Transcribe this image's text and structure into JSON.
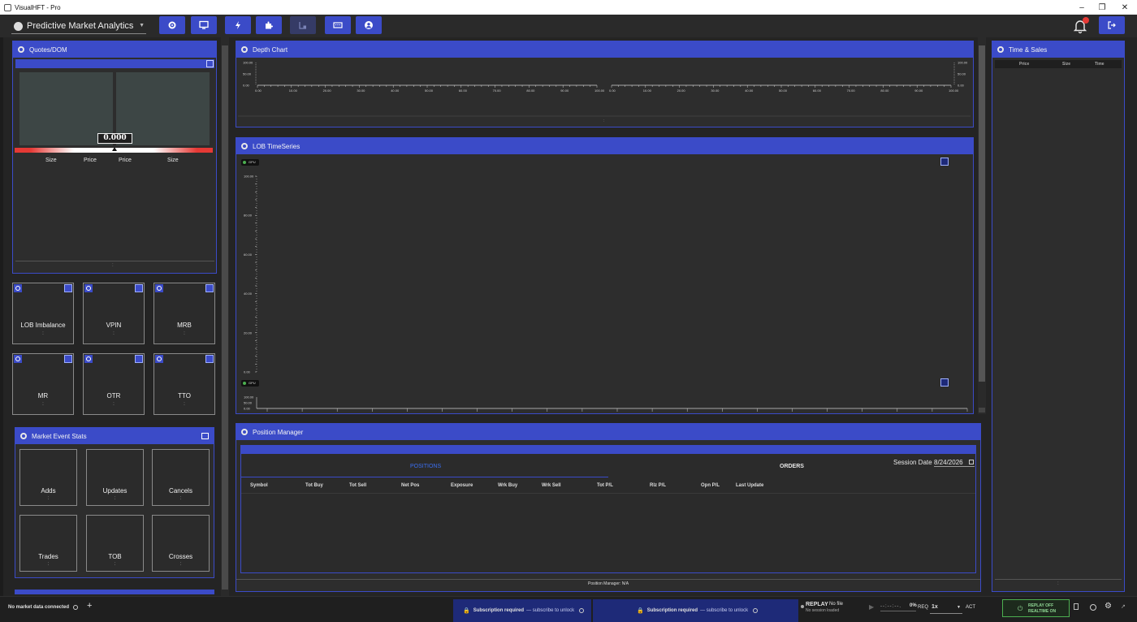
{
  "window": {
    "title": "VisualHFT - Pro"
  },
  "toolbar": {
    "study_select": "Predictive Market Analytics"
  },
  "notifications": {
    "count": ""
  },
  "quotes": {
    "title": "Quotes/DOM",
    "mid_price": "0.000",
    "cols": [
      "Size",
      "Price",
      "Price",
      "Size"
    ]
  },
  "tiles": [
    {
      "label": "LOB Imbalance"
    },
    {
      "label": "VPIN"
    },
    {
      "label": "MRB"
    },
    {
      "label": "MR"
    },
    {
      "label": "OTR"
    },
    {
      "label": "TTO"
    }
  ],
  "market_event_stats": {
    "title": "Market Event Stats",
    "items": [
      "Adds",
      "Updates",
      "Cancels",
      "Trades",
      "TOB",
      "Crosses"
    ]
  },
  "depth_chart": {
    "title": "Depth Chart",
    "y_ticks": [
      "100.00",
      "50.00",
      "0.00"
    ],
    "x_ticks": [
      "0.00",
      "10.00",
      "20.00",
      "30.00",
      "40.00",
      "50.00",
      "60.00",
      "70.00",
      "80.00",
      "90.00",
      "100.00"
    ]
  },
  "lob_timeseries": {
    "title": "LOB TimeSeries",
    "gpu_label": "GPU",
    "y_ticks": [
      "100.00",
      "80.00",
      "60.00",
      "40.00",
      "20.00",
      "0.00"
    ],
    "small_y_ticks": [
      "100.00",
      "50.00",
      "0.00"
    ]
  },
  "position_manager": {
    "title": "Position Manager",
    "tabs": [
      "POSITIONS",
      "ORDERS"
    ],
    "session_label": "Session Date",
    "session_date": "8/24/2026",
    "columns": [
      "Symbol",
      "Tot Buy",
      "Tot Sell",
      "Net Pos",
      "Exposure",
      "Wrk Buy",
      "Wrk Sell",
      "Tot P/L",
      "Rlz P/L",
      "Opn P/L",
      "Last Update"
    ],
    "footer": "Position Manager: N/A"
  },
  "time_sales": {
    "title": "Time & Sales",
    "columns": [
      "Price",
      "Size",
      "Time"
    ]
  },
  "status_bar": {
    "connection": "No market data connected",
    "subscription_title": "Subscription required",
    "subscription_text": "— subscribe to unlock",
    "replay_label": "REPLAY",
    "replay_file": "No file",
    "replay_session": "No session loaded",
    "time": "--:--:--.",
    "percent": "0%",
    "req": "REQ",
    "speed": "1x",
    "act": "ACT",
    "replay_off": "REPLAY OFF",
    "realtime_on": "REALTIME ON"
  },
  "colors": {
    "accent": "#3b4bc8",
    "panel_bg": "#2d2d2d",
    "window_bg": "#1c1c1c",
    "success": "#4caf50"
  }
}
